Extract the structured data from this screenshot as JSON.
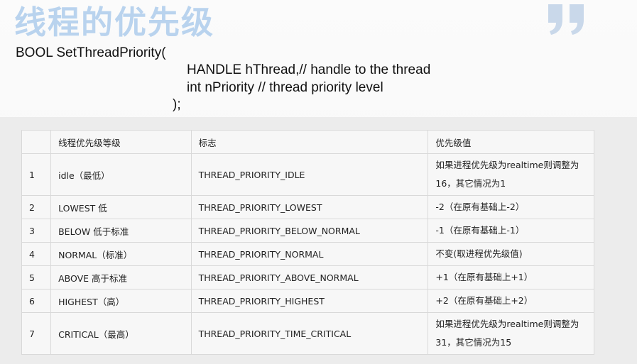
{
  "slide": {
    "title": "线程的优先级",
    "accent_color": "#b9d3ee",
    "decoration_icon": "quote-mark-icon"
  },
  "code": {
    "line1": "BOOL SetThreadPriority(",
    "line2": "HANDLE hThread,// handle to the thread",
    "line3": "int nPriority // thread priority level",
    "line4": ");"
  },
  "table": {
    "headers": [
      "",
      "线程优先级等级",
      "标志",
      "优先级值"
    ],
    "rows": [
      {
        "num": "1",
        "level": "idle（最低）",
        "flag": "THREAD_PRIORITY_IDLE",
        "value": "如果进程优先级为realtime则调整为16，其它情况为1"
      },
      {
        "num": "2",
        "level": "LOWEST 低",
        "flag": "THREAD_PRIORITY_LOWEST",
        "value": "-2（在原有基础上-2）"
      },
      {
        "num": "3",
        "level": "BELOW 低于标准",
        "flag": "THREAD_PRIORITY_BELOW_NORMAL",
        "value": "-1（在原有基础上-1）"
      },
      {
        "num": "4",
        "level": "NORMAL（标准）",
        "flag": "THREAD_PRIORITY_NORMAL",
        "value": "不变(取进程优先级值)"
      },
      {
        "num": "5",
        "level": "ABOVE 高于标准",
        "flag": "THREAD_PRIORITY_ABOVE_NORMAL",
        "value": "+1（在原有基础上+1）"
      },
      {
        "num": "6",
        "level": "HIGHEST（高）",
        "flag": "THREAD_PRIORITY_HIGHEST",
        "value": "+2（在原有基础上+2）"
      },
      {
        "num": "7",
        "level": "CRITICAL（最高）",
        "flag": "THREAD_PRIORITY_TIME_CRITICAL",
        "value": "如果进程优先级为realtime则调整为31，其它情况为15"
      }
    ]
  }
}
